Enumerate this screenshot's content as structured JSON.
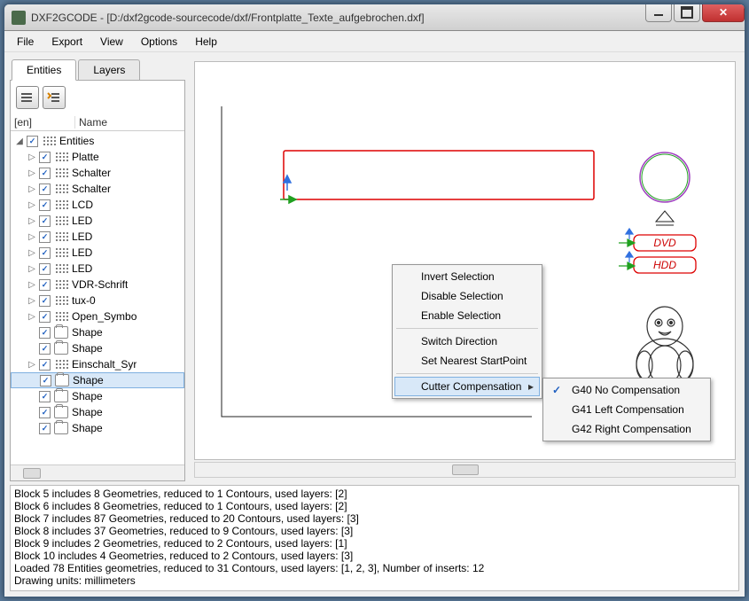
{
  "window": {
    "title": "DXF2GCODE - [D:/dxf2gcode-sourcecode/dxf/Frontplatte_Texte_aufgebrochen.dxf]"
  },
  "menu": [
    "File",
    "Export",
    "View",
    "Options",
    "Help"
  ],
  "tabs": {
    "entities": "Entities",
    "layers": "Layers"
  },
  "tree_header": {
    "col1": "[en]",
    "col2": "Name"
  },
  "tree": [
    {
      "indent": 0,
      "exp": "◢",
      "icon": "grid",
      "label": "Entities",
      "cbx": 1
    },
    {
      "indent": 1,
      "exp": "▷",
      "icon": "grid",
      "label": "Platte",
      "cbx": 1
    },
    {
      "indent": 1,
      "exp": "▷",
      "icon": "grid",
      "label": "Schalter",
      "cbx": 1
    },
    {
      "indent": 1,
      "exp": "▷",
      "icon": "grid",
      "label": "Schalter",
      "cbx": 1
    },
    {
      "indent": 1,
      "exp": "▷",
      "icon": "grid",
      "label": "LCD",
      "cbx": 1
    },
    {
      "indent": 1,
      "exp": "▷",
      "icon": "grid",
      "label": "LED",
      "cbx": 1
    },
    {
      "indent": 1,
      "exp": "▷",
      "icon": "grid",
      "label": "LED",
      "cbx": 1
    },
    {
      "indent": 1,
      "exp": "▷",
      "icon": "grid",
      "label": "LED",
      "cbx": 1
    },
    {
      "indent": 1,
      "exp": "▷",
      "icon": "grid",
      "label": "LED",
      "cbx": 1
    },
    {
      "indent": 1,
      "exp": "▷",
      "icon": "grid",
      "label": "VDR-Schrift",
      "cbx": 1
    },
    {
      "indent": 1,
      "exp": "▷",
      "icon": "grid",
      "label": "tux-0",
      "cbx": 1
    },
    {
      "indent": 1,
      "exp": "▷",
      "icon": "grid",
      "label": "Open_Symbo",
      "cbx": 1
    },
    {
      "indent": 1,
      "exp": "",
      "icon": "folder",
      "label": "Shape",
      "cbx": 1
    },
    {
      "indent": 1,
      "exp": "",
      "icon": "folder",
      "label": "Shape",
      "cbx": 1
    },
    {
      "indent": 1,
      "exp": "▷",
      "icon": "grid",
      "label": "Einschalt_Syr",
      "cbx": 1
    },
    {
      "indent": 1,
      "exp": "",
      "icon": "folder",
      "label": "Shape",
      "cbx": 1,
      "selected": true
    },
    {
      "indent": 1,
      "exp": "",
      "icon": "folder",
      "label": "Shape",
      "cbx": 1
    },
    {
      "indent": 1,
      "exp": "",
      "icon": "folder",
      "label": "Shape",
      "cbx": 1
    },
    {
      "indent": 1,
      "exp": "",
      "icon": "folder",
      "label": "Shape",
      "cbx": 1
    }
  ],
  "context_menu": {
    "invert": "Invert Selection",
    "disable": "Disable Selection",
    "enable": "Enable Selection",
    "switch": "Switch Direction",
    "nearest": "Set Nearest StartPoint",
    "cutter": "Cutter Compensation"
  },
  "submenu": {
    "g40": "G40 No Compensation",
    "g41": "G41 Left Compensation",
    "g42": "G42 Right Compensation"
  },
  "canvas_labels": {
    "dvd": "DVD",
    "hdd": "HDD"
  },
  "log": [
    "Block 5 includes 8 Geometries, reduced to 1 Contours, used layers: [2]",
    "Block 6 includes 8 Geometries, reduced to 1 Contours, used layers: [2]",
    "Block 7 includes 87 Geometries, reduced to 20 Contours, used layers: [3]",
    "Block 8 includes 37 Geometries, reduced to 9 Contours, used layers: [3]",
    "Block 9 includes 2 Geometries, reduced to 2 Contours, used layers: [1]",
    "Block 10 includes 4 Geometries, reduced to 2 Contours, used layers: [3]",
    "Loaded 78 Entities geometries, reduced to 31 Contours, used layers: [1, 2, 3], Number of inserts: 12",
    "Drawing units: millimeters"
  ]
}
